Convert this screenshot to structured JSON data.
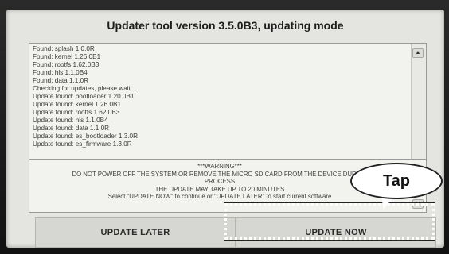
{
  "title": "Updater tool version 3.5.0B3, updating mode",
  "log": {
    "lines": [
      "Found: splash 1.0.0R",
      "Found: kernel 1.26.0B1",
      "Found: rootfs 1.62.0B3",
      "Found: hls 1.1.0B4",
      "Found: data 1.1.0R",
      "Checking for updates, please wait...",
      "Update found: bootloader 1.20.0B1",
      "Update found: kernel 1.26.0B1",
      "Update found: rootfs 1.62.0B3",
      "Update found: hls 1.1.0B4",
      "Update found: data 1.1.0R",
      "Update found: es_bootloader 1.3.0R",
      "Update found: es_firmware 1.3.0R"
    ],
    "scroll_up_glyph": "▲"
  },
  "warning": {
    "lines": [
      "***WARNING***",
      "DO NOT POWER OFF THE SYSTEM OR REMOVE THE MICRO SD CARD FROM THE DEVICE DURING",
      "PROCESS",
      "THE UPDATE MAY TAKE UP TO 20 MINUTES",
      "Select \"UPDATE NOW\" to continue or \"UPDATE LATER\" to start current software"
    ],
    "scroll_down_glyph": "▼"
  },
  "buttons": {
    "later_label": "UPDATE LATER",
    "now_label": "UPDATE NOW"
  },
  "callout": {
    "label": "Tap"
  }
}
